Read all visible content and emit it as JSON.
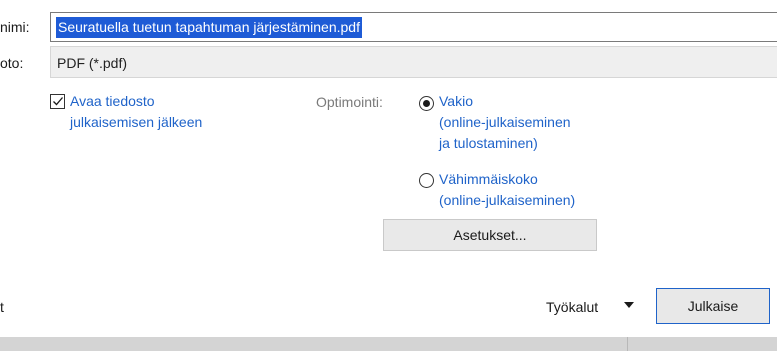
{
  "filename": {
    "label": "nimi:",
    "value": "Seuratuella tuetun tapahtuman järjestäminen.pdf"
  },
  "filetype": {
    "label": "oto:",
    "value": "PDF (*.pdf)"
  },
  "open_after": {
    "label_line1": "Avaa tiedosto",
    "label_line2": "julkaisemisen jälkeen",
    "checked": true
  },
  "optimization": {
    "label": "Optimointi:",
    "standard": {
      "title": "Vakio",
      "desc_line1": "(online-julkaiseminen",
      "desc_line2": "ja tulostaminen)",
      "selected": true
    },
    "minimum": {
      "title": "Vähimmäiskoko",
      "desc_line1": "(online-julkaiseminen)",
      "selected": false
    }
  },
  "settings_button": "Asetukset...",
  "bottom_left_text": "t",
  "tools_label": "Työkalut",
  "publish_button": "Julkaise",
  "colors": {
    "accent": "#1f63c9",
    "selection": "#1e5bd6"
  }
}
